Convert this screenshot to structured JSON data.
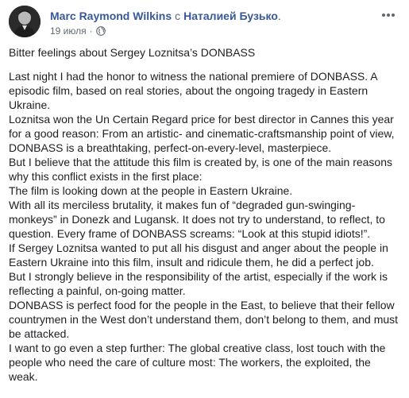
{
  "post": {
    "author_name": "Marc Raymond Wilkins",
    "with_word": "с",
    "tagged_person": "Наталией Бузько",
    "tagged_suffix": ".",
    "date": "19 июля",
    "separator": "·",
    "privacy_icon": "globe-icon",
    "more_icon": "more-horizontal-icon",
    "title": "Bitter feelings about Sergey Loznitsa’s DONBASS",
    "paragraphs": [
      "Last night I had the honor to witness the national premiere of DONBASS. A episodic film, based on real stories, about the ongoing tragedy in Eastern Ukraine.",
      "Loznitsa won the Un Certain Regard price for best director in Cannes this year for a good reason: From an artistic- and cinematic-craftsmanship point of view, DONBASS is a breathtaking, perfect-on-every-level, masterpiece.",
      "But I believe that the attitude this film is created by, is one of the main reasons why this conflict exists in the first place:",
      "The film is looking down at the people in Eastern Ukraine.",
      "With all its merciless brutality, it makes fun of “degraded gun-swinging-monkeys” in Donezk and Lugansk. It does not try to understand, to reflect, to question. Every frame of DONBASS screams: “Look at this stupid idiots!”.",
      "If Sergey Loznitsa wanted to put all his disgust and anger about the people in Eastern Ukraine into this film, insult and ridicule them, he did a perfect job.",
      "But I strongly believe in the responsibility of the artist, especially if the work is reflecting a painful, on-going matter.",
      "DONBASS is perfect food for the people in the East, to believe that their fellow countrymen in the West don’t understand them, don’t belong to them, and must be attacked.",
      "I want to go even a step further: The global creative class, lost touch with the people who need the care of culture most: The workers, the exploited, the weak."
    ]
  },
  "colors": {
    "link": "#385898",
    "text": "#1c1e21",
    "meta": "#616770",
    "background": "#ffffff"
  }
}
